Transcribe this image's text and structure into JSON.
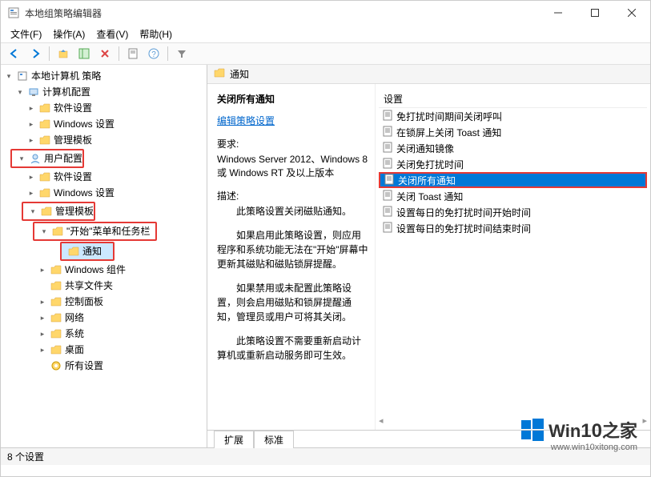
{
  "window": {
    "title": "本地组策略编辑器"
  },
  "menu": {
    "file": "文件(F)",
    "action": "操作(A)",
    "view": "查看(V)",
    "help": "帮助(H)"
  },
  "tree": {
    "root": "本地计算机 策略",
    "computer": "计算机配置",
    "c_software": "软件设置",
    "c_windows": "Windows 设置",
    "c_templates": "管理模板",
    "user": "用户配置",
    "u_software": "软件设置",
    "u_windows": "Windows 设置",
    "u_templates": "管理模板",
    "start_taskbar": "\"开始\"菜单和任务栏",
    "notifications": "通知",
    "win_components": "Windows 组件",
    "shared_folders": "共享文件夹",
    "control_panel": "控制面板",
    "network": "网络",
    "system": "系统",
    "desktop": "桌面",
    "all_settings": "所有设置"
  },
  "header": {
    "title": "通知"
  },
  "desc": {
    "heading": "关闭所有通知",
    "edit_link": "编辑策略设置",
    "req_label": "要求:",
    "req_text": "Windows Server 2012、Windows 8 或 Windows RT 及以上版本",
    "desc_label": "描述:",
    "p1": "此策略设置关闭磁贴通知。",
    "p2": "如果启用此策略设置，则应用程序和系统功能无法在\"开始\"屏幕中更新其磁贴和磁贴锁屏提醒。",
    "p3": "如果禁用或未配置此策略设置，则会启用磁贴和锁屏提醒通知，管理员或用户可将其关闭。",
    "p4": "此策略设置不需要重新启动计算机或重新启动服务即可生效。"
  },
  "list": {
    "col_header": "设置",
    "items": [
      "免打扰时间期间关闭呼叫",
      "在锁屏上关闭 Toast 通知",
      "关闭通知镜像",
      "关闭免打扰时间",
      "关闭所有通知",
      "关闭 Toast 通知",
      "设置每日的免打扰时间开始时间",
      "设置每日的免打扰时间结束时间"
    ],
    "selected_index": 4
  },
  "tabs": {
    "extended": "扩展",
    "standard": "标准"
  },
  "status": {
    "text": "8 个设置"
  },
  "watermark": {
    "brand_pre": "Win",
    "brand_num": "10",
    "brand_suf": "之家",
    "url": "www.win10xitong.com"
  }
}
